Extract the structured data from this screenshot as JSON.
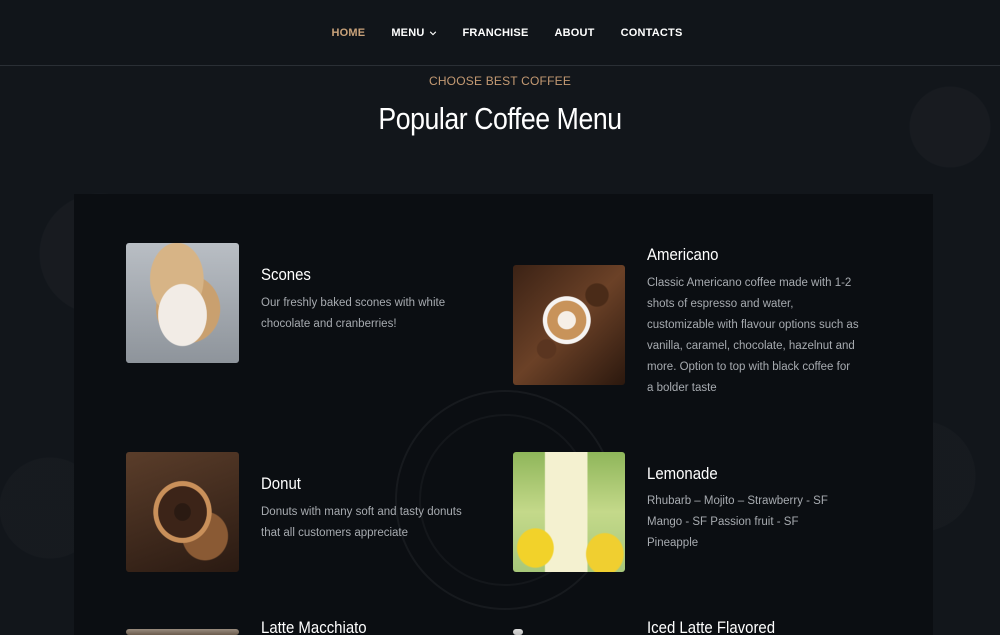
{
  "nav": {
    "items": [
      {
        "label": "HOME",
        "active": true
      },
      {
        "label": "MENU",
        "dropdown": true
      },
      {
        "label": "FRANCHISE"
      },
      {
        "label": "ABOUT"
      },
      {
        "label": "CONTACTS"
      }
    ]
  },
  "section": {
    "subtitle": "CHOOSE BEST COFFEE",
    "title": "Popular Coffee Menu"
  },
  "menu_items": [
    {
      "name": "Scones",
      "description": "Our freshly baked scones with white chocolate and cranberries!",
      "image_icon": "scones-photo"
    },
    {
      "name": "Americano",
      "description": "Classic Americano coffee made with 1-2 shots of espresso and water, customizable with flavour options such as vanilla, caramel, chocolate, hazelnut and more. Option to top with black coffee for a bolder taste",
      "image_icon": "americano-photo"
    },
    {
      "name": "Donut",
      "description": "Donuts with many soft and tasty donuts that all customers appreciate",
      "image_icon": "donut-photo"
    },
    {
      "name": "Lemonade",
      "description": "Rhubarb – Mojito – Strawberry - SF Mango - SF Passion fruit - SF Pineapple",
      "image_icon": "lemonade-photo"
    },
    {
      "name": "Latte Macchiato",
      "description": "",
      "image_icon": "latte-photo"
    },
    {
      "name": "Iced Latte Flavored",
      "description": "",
      "image_icon": "iced-latte-photo"
    }
  ],
  "colors": {
    "accent": "#c9a27a",
    "background": "#12161b",
    "panel": "#0b0e12",
    "muted_text": "#a7abb0"
  }
}
